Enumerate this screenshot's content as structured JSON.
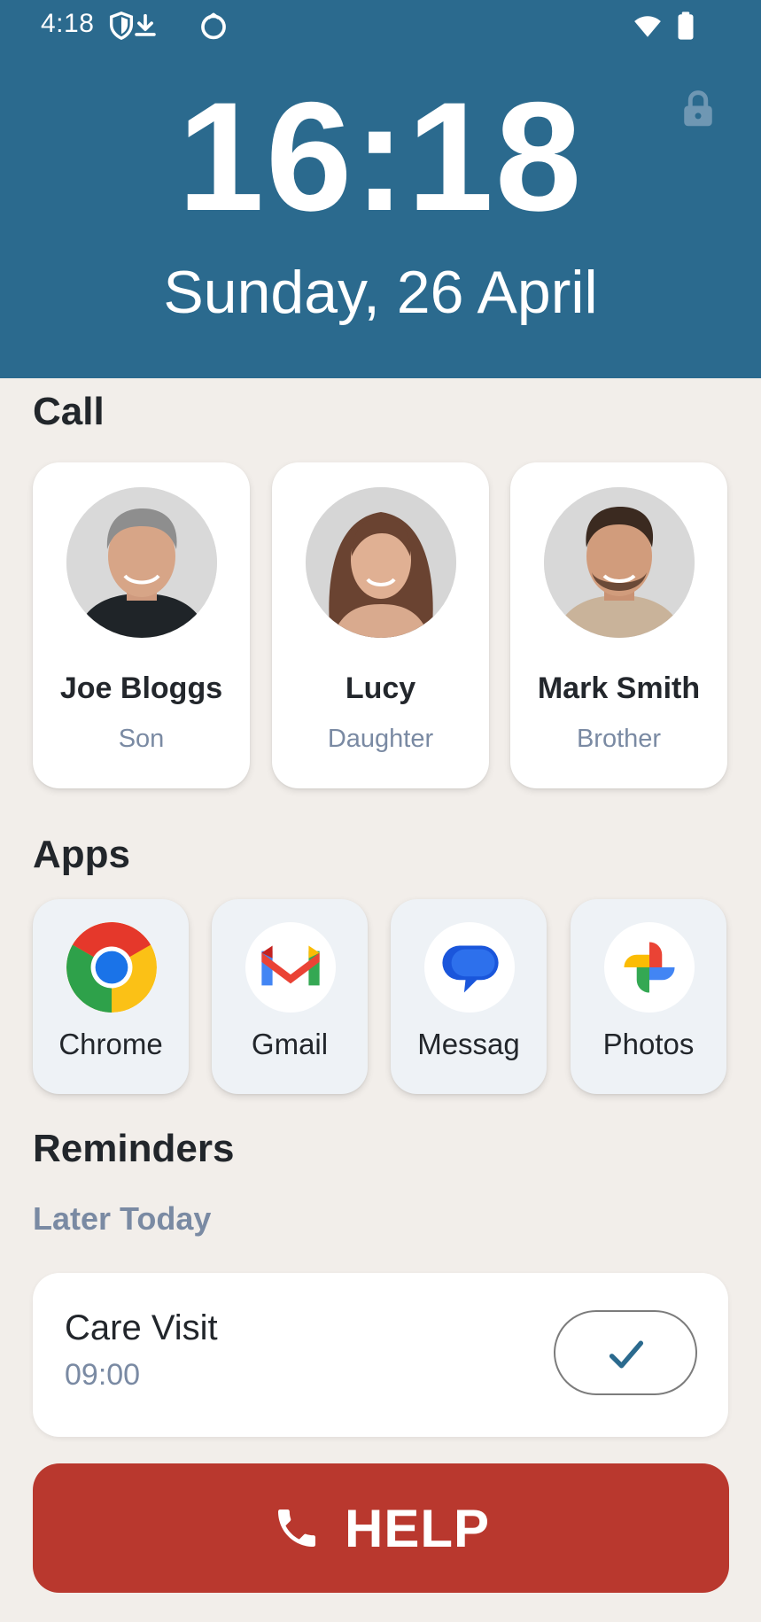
{
  "status_bar": {
    "time": "4:18",
    "icons": [
      "shield-icon",
      "download-icon",
      "circle-sync-icon",
      "wifi-icon",
      "battery-icon"
    ]
  },
  "header": {
    "clock": "16:18",
    "date": "Sunday, 26 April",
    "lock_icon": "lock-icon",
    "background": "#2b6a8e"
  },
  "call": {
    "title": "Call",
    "contacts": [
      {
        "name": "Joe Bloggs",
        "relation": "Son"
      },
      {
        "name": "Lucy",
        "relation": "Daughter"
      },
      {
        "name": "Mark Smith",
        "relation": "Brother"
      }
    ]
  },
  "apps": {
    "title": "Apps",
    "items": [
      {
        "label": "Chrome",
        "icon": "chrome-icon"
      },
      {
        "label": "Gmail",
        "icon": "gmail-icon"
      },
      {
        "label": "Messag",
        "icon": "messages-icon"
      },
      {
        "label": "Photos",
        "icon": "photos-icon"
      }
    ]
  },
  "reminders": {
    "title": "Reminders",
    "subheading": "Later Today",
    "items": [
      {
        "title": "Care Visit",
        "time": "09:00"
      }
    ]
  },
  "help": {
    "label": "HELP",
    "color": "#b9382e"
  }
}
